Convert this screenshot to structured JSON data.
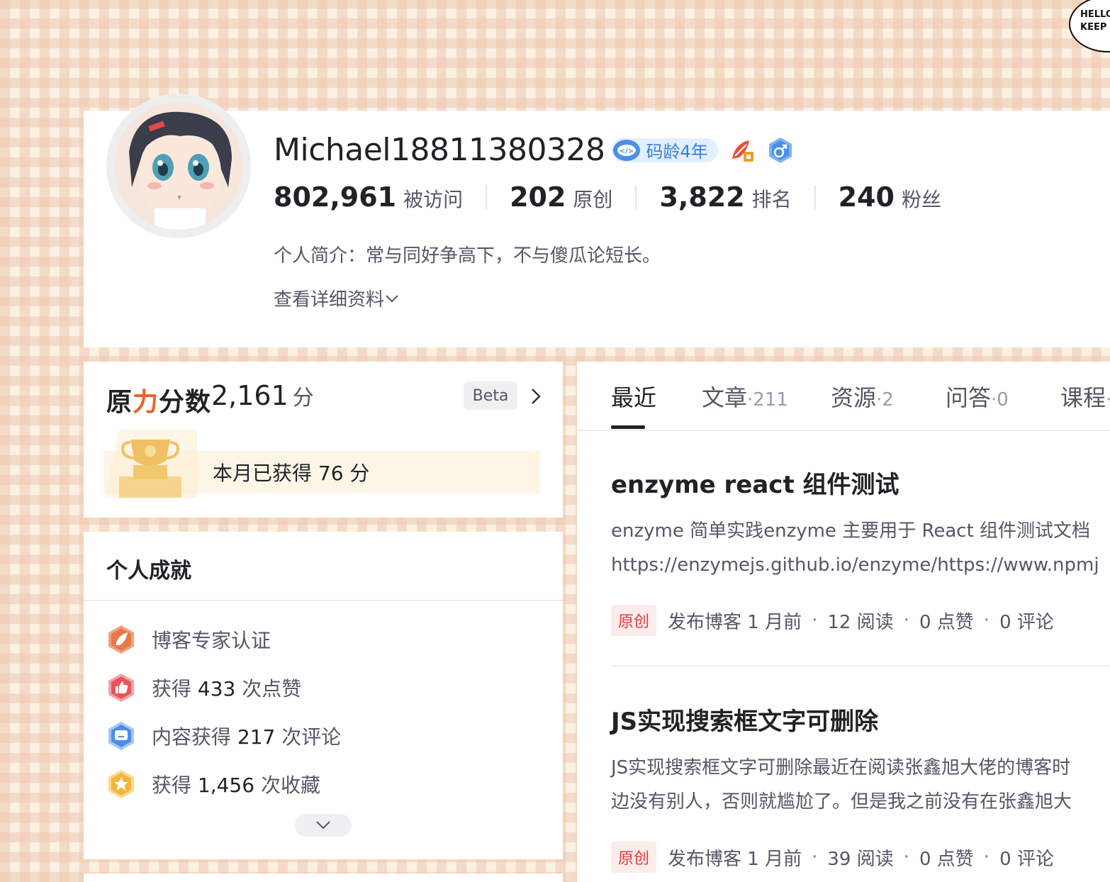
{
  "sticker": {
    "line1": "HELLO",
    "line2": "KEEP"
  },
  "profile": {
    "username": "Michael18811380328",
    "code_age_badge": "码龄4年",
    "stats": [
      {
        "value": "802,961",
        "label": "被访问"
      },
      {
        "value": "202",
        "label": "原创"
      },
      {
        "value": "3,822",
        "label": "排名"
      },
      {
        "value": "240",
        "label": "粉丝"
      }
    ],
    "bio": "个人简介：常与同好争高下，不与傻瓜论短长。",
    "more_link": "查看详细资料"
  },
  "score": {
    "title_part1": "原",
    "title_part2": "力",
    "title_part3": "分数",
    "value": "2,161",
    "unit": "分",
    "beta": "Beta",
    "monthly": "本月已获得 76 分"
  },
  "achievements": {
    "title": "个人成就",
    "items": [
      {
        "prefix": "博客专家认证",
        "num": "",
        "suffix": "",
        "icon": "expert-icon",
        "color": "#e8784a"
      },
      {
        "prefix": "获得 ",
        "num": "433",
        "suffix": " 次点赞",
        "icon": "like-icon",
        "color": "#e8545a"
      },
      {
        "prefix": "内容获得 ",
        "num": "217",
        "suffix": " 次评论",
        "icon": "comment-icon",
        "color": "#4d8ce6"
      },
      {
        "prefix": "获得 ",
        "num": "1,456",
        "suffix": " 次收藏",
        "icon": "star-icon",
        "color": "#f3b53c"
      }
    ]
  },
  "tabs": [
    {
      "label": "最近",
      "count": ""
    },
    {
      "label": "文章",
      "count": "·211"
    },
    {
      "label": "资源",
      "count": "·2"
    },
    {
      "label": "问答",
      "count": "·0"
    },
    {
      "label": "课程",
      "count": "·"
    }
  ],
  "articles": [
    {
      "title": "enzyme react 组件测试",
      "desc_line1": "enzyme 简单实践enzyme 主要用于 React 组件测试文档",
      "desc_line2": "https://enzymejs.github.io/enzyme/https://www.npmj",
      "tag": "原创",
      "published": "发布博客 1 月前",
      "reads": "12 阅读",
      "likes": "0 点赞",
      "comments": "0 评论"
    },
    {
      "title": "JS实现搜索框文字可删除",
      "desc_line1": "JS实现搜索框文字可删除最近在阅读张鑫旭大佬的博客时",
      "desc_line2": "边没有别人，否则就尴尬了。但是我之前没有在张鑫旭大",
      "tag": "原创",
      "published": "发布博客 1 月前",
      "reads": "39 阅读",
      "likes": "0 点赞",
      "comments": "0 评论"
    }
  ]
}
